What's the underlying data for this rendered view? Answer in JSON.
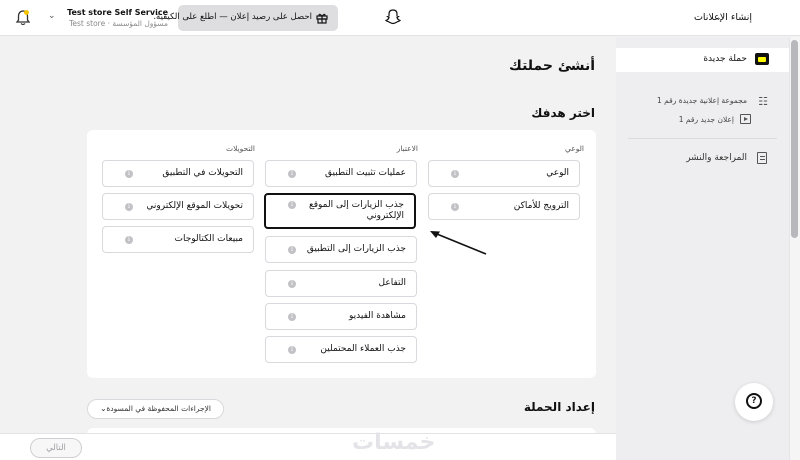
{
  "topbar": {
    "account_name": "Test store Self Service",
    "account_role": "Test store · مسؤول المؤسسة",
    "promo_text": "احصل على رصيد إعلان — اطلع على الكيفية.",
    "create_ads_menu": "إنشاء الإعلانات"
  },
  "sidebar": {
    "new_campaign": "حملة جديدة",
    "ad_group": "مجموعة إعلانية جديدة رقم 1",
    "new_ad": "إعلان جديد رقم 1",
    "review_publish": "المراجعة والنشر"
  },
  "main": {
    "page_title": "أنشئ حملتك",
    "goal_title": "اختر هدفك",
    "columns": {
      "awareness": "الوعي",
      "consideration": "الاعتبار",
      "conversions": "التحويلات"
    },
    "goals": {
      "awareness": [
        "الوعي",
        "الترويج للأماكن"
      ],
      "consideration": [
        "عمليات تثبيت التطبيق",
        "جذب الزيارات إلى الموقع الإلكتروني",
        "جذب الزيارات إلى التطبيق",
        "التفاعل",
        "مشاهدة الفيديو",
        "جذب العملاء المحتملين"
      ],
      "conversions": [
        "التحويلات في التطبيق",
        "تحويلات الموقع الإلكتروني",
        "مبيعات الكتالوجات"
      ]
    },
    "selected_goal": "جذب الزيارات إلى الموقع الإلكتروني",
    "setup_title": "إعداد الحملة",
    "drafts_label": "الإجراءات المحفوظة في المسودة"
  },
  "footer": {
    "next_button": "التالي",
    "watermark": "خمسات"
  },
  "icons": {
    "info": "i",
    "help": "?"
  },
  "colors": {
    "brand_yellow": "#fffc00"
  }
}
